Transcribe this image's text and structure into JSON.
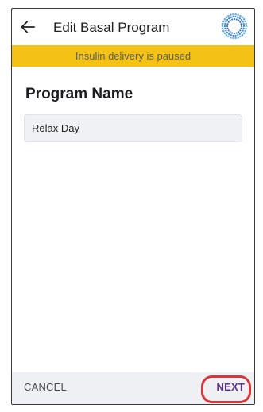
{
  "header": {
    "back_icon": "arrow-left-icon",
    "title": "Edit Basal Program",
    "pod_icon": "pod-status-icon"
  },
  "banner": {
    "text": "Insulin delivery is paused",
    "color": "#f4c214"
  },
  "form": {
    "section_title": "Program Name",
    "program_name_value": "Relax Day"
  },
  "footer": {
    "cancel_label": "CANCEL",
    "next_label": "NEXT",
    "next_color": "#5a2d91",
    "highlight_color": "#d6373b"
  }
}
